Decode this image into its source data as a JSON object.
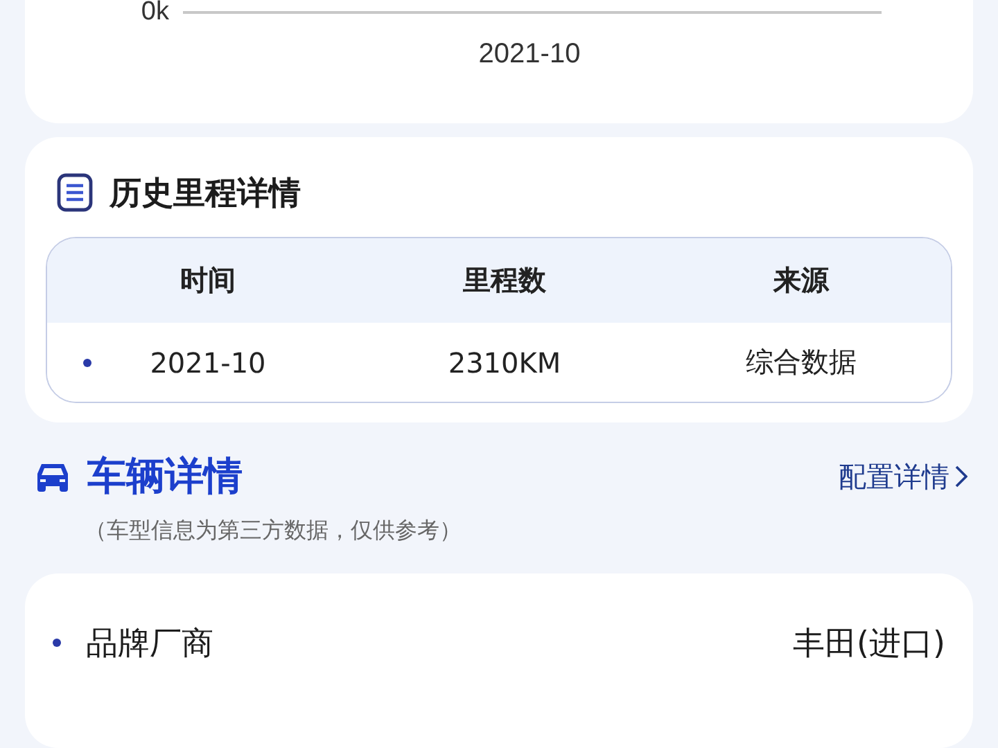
{
  "mileage_chart": {
    "y_tick": "0k",
    "x_label": "2021-10"
  },
  "history": {
    "title": "历史里程详情",
    "columns": [
      "时间",
      "里程数",
      "来源"
    ],
    "rows": [
      {
        "cells": [
          "2021-10",
          "2310KM",
          "综合数据"
        ]
      }
    ]
  },
  "vehicle": {
    "title": "车辆详情",
    "link": "配置详情",
    "note": "（车型信息为第三方数据，仅供参考）",
    "rows": [
      {
        "label": "品牌厂商",
        "value": "丰田(进口)"
      }
    ]
  }
}
